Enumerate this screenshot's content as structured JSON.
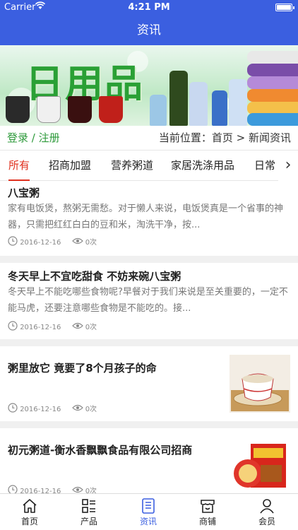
{
  "status_bar": {
    "carrier": "Carrier",
    "time": "4:21 PM"
  },
  "nav": {
    "title": "资讯"
  },
  "banner": {
    "logo_text": "日用品"
  },
  "auth": {
    "login": "登录",
    "separator": " / ",
    "register": "注册"
  },
  "location": {
    "label": "当前位置：",
    "home": "首页",
    "sep": " > ",
    "current": "新闻资讯"
  },
  "tabs": [
    {
      "label": "所有",
      "active": true
    },
    {
      "label": "招商加盟"
    },
    {
      "label": "营养粥道"
    },
    {
      "label": "家居洗涤用品"
    },
    {
      "label": "日常"
    }
  ],
  "articles": [
    {
      "title": "八宝粥",
      "summary": "家有电饭煲，熬粥无需愁。对于懒人来说，电饭煲真是一个省事的神器，只需把红红白白的豆和米，淘洗干净，按...",
      "date": "2016-12-16",
      "views": "0次"
    },
    {
      "title": "冬天早上不宜吃甜食 不妨来碗八宝粥",
      "summary": "冬天早上不能吃哪些食物呢?早餐对于我们来说是至关重要的，一定不能马虎，还要注意哪些食物是不能吃的。接...",
      "date": "2016-12-16",
      "views": "0次"
    },
    {
      "title": "粥里放它 竟要了8个月孩子的命",
      "date": "2016-12-16",
      "views": "0次",
      "thumb": "porridge-bowl"
    },
    {
      "title": "初元粥道-衡水香飘飘食品有限公司招商",
      "date": "2016-12-16",
      "views": "0次",
      "thumb": "gift-box"
    }
  ],
  "tabbar": [
    {
      "label": "首页",
      "icon": "home-icon"
    },
    {
      "label": "产品",
      "icon": "grid-list-icon"
    },
    {
      "label": "资讯",
      "icon": "news-icon",
      "active": true
    },
    {
      "label": "商铺",
      "icon": "shop-icon"
    },
    {
      "label": "会员",
      "icon": "user-icon"
    }
  ],
  "colors": {
    "primary": "#3b5fe0",
    "accent_red": "#e0301e",
    "login_green": "#2e9a3b"
  }
}
